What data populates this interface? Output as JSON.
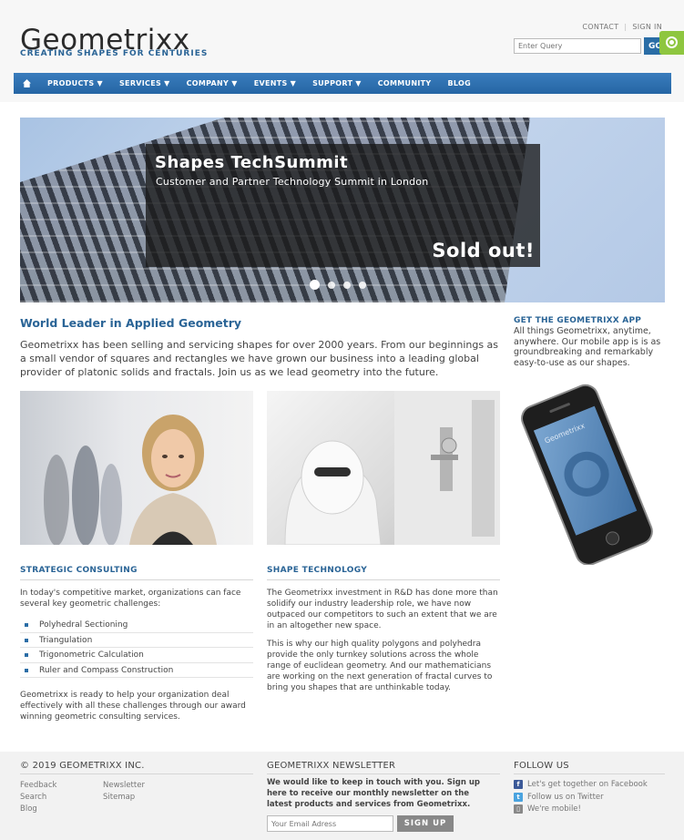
{
  "brand": {
    "name": "Geometrixx",
    "tagline": "CREATING SHAPES FOR CENTURIES"
  },
  "toplinks": {
    "contact": "CONTACT",
    "signin": "SIGN IN"
  },
  "search": {
    "placeholder": "Enter Query",
    "button": "GO"
  },
  "nav": {
    "home_icon": "home-icon",
    "items": [
      {
        "label": "PRODUCTS ▼"
      },
      {
        "label": "SERVICES ▼"
      },
      {
        "label": "COMPANY ▼"
      },
      {
        "label": "EVENTS ▼"
      },
      {
        "label": "SUPPORT ▼"
      },
      {
        "label": "COMMUNITY"
      },
      {
        "label": "BLOG"
      }
    ]
  },
  "hero": {
    "title": "Shapes TechSummit",
    "subtitle": "Customer and Partner Technology Summit in London",
    "badge": "Sold out!",
    "slide_count": 4,
    "active_slide": 1
  },
  "intro": {
    "heading": "World Leader in Applied Geometry",
    "text": "Geometrixx has been selling and servicing shapes for over 2000 years. From our beginnings as a small vendor of squares and rectangles we have grown our business into a leading global provider of platonic solids and fractals. Join us as we lead geometry into the future."
  },
  "consulting": {
    "heading": "STRATEGIC CONSULTING",
    "intro": "In today's competitive market, organizations can face several key geometric challenges:",
    "items": [
      "Polyhedral Sectioning",
      "Triangulation",
      "Trigonometric Calculation",
      "Ruler and Compass Construction"
    ],
    "outro": "Geometrixx is ready to help your organization deal effectively with all these challenges through our award winning geometric consulting services."
  },
  "technology": {
    "heading": "SHAPE TECHNOLOGY",
    "p1": "The Geometrixx investment in R&D has done more than solidify our industry leadership role, we have now outpaced our competitors to such an extent that we are in an altogether new space.",
    "p2": "This is why our high quality polygons and polyhedra provide the only turnkey solutions across the whole range of euclidean geometry. And our mathematicians are working on the next generation of fractal curves to bring you shapes that are unthinkable today."
  },
  "app": {
    "heading": "GET THE GEOMETRIXX APP",
    "text": "All things Geometrixx, anytime, anywhere. Our mobile app is is as groundbreaking and remarkably easy-to-use as our shapes.",
    "phone_brand": "Geometrixx"
  },
  "footer": {
    "copyright": "© 2019 GEOMETRIXX INC.",
    "links_col1": [
      "Feedback",
      "Search",
      "Blog"
    ],
    "links_col2": [
      "Newsletter",
      "Sitemap"
    ],
    "newsletter_heading": "GEOMETRIXX NEWSLETTER",
    "newsletter_text": "We would like to keep in touch with you. Sign up here to receive our monthly newsletter on the latest products and services from Geometrixx.",
    "email_placeholder": "Your Email Adress",
    "signup_button": "SIGN UP",
    "follow_heading": "FOLLOW US",
    "follow": [
      {
        "label": "Let's get together on Facebook",
        "icon": "facebook-icon",
        "color": "#3b5998"
      },
      {
        "label": "Follow us on Twitter",
        "icon": "twitter-icon",
        "color": "#4aa3df"
      },
      {
        "label": "We're mobile!",
        "icon": "mobile-icon",
        "color": "#888888"
      }
    ]
  },
  "colors": {
    "accent": "#2a6496",
    "nav": "#2a6da6",
    "widget": "#8ec63f"
  }
}
